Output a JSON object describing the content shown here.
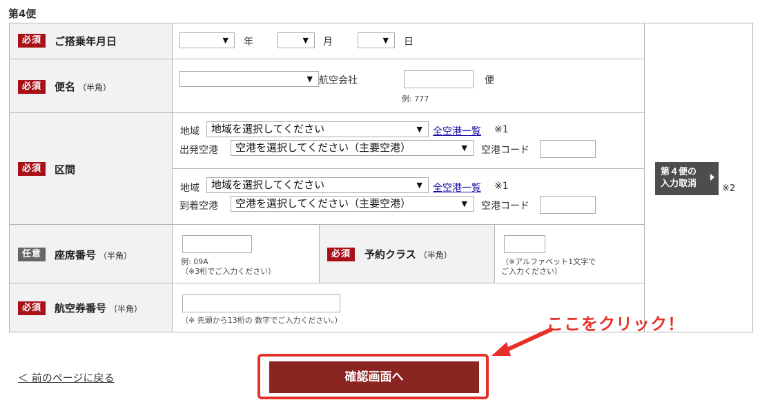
{
  "section_title": "第4便",
  "badges": {
    "required": "必須",
    "optional": "任意"
  },
  "rows": {
    "date": {
      "label": "ご搭乗年月日",
      "year_unit": "年",
      "month_unit": "月",
      "day_unit": "日"
    },
    "flight": {
      "label": "便名",
      "hint": "（半角）",
      "airline_text": "航空会社",
      "flight_unit": "便",
      "example": "例: 777"
    },
    "route": {
      "label": "区間",
      "region_label": "地域",
      "region_placeholder": "地域を選択してください",
      "all_airports_link": "全空港一覧",
      "note_mark_1": "※1",
      "departure_label": "出発空港",
      "arrival_label": "到着空港",
      "airport_placeholder": "空港を選択してください（主要空港）",
      "airport_code_label": "空港コード"
    },
    "seat": {
      "label": "座席番号",
      "hint": "（半角）",
      "example": "例: 09A",
      "note": "（※3桁でご入力ください）"
    },
    "class": {
      "label": "予約クラス",
      "hint": "（半角）",
      "note_line1": "（※アルファベット1文字で",
      "note_line2": "ご入力ください）"
    },
    "ticket": {
      "label": "航空券番号",
      "hint": "（半角）",
      "note": "（※ 先頭から13桁の 数字でご入力ください。）"
    }
  },
  "cancel_button": {
    "line1": "第４便の",
    "line2": "入力取消"
  },
  "note_mark_2": "※2",
  "back_link": "＜ 前のページに戻る",
  "confirm_button": "確認画面へ",
  "callout_text": "ここをクリック！",
  "colors": {
    "required_badge": "#a8111a",
    "optional_badge": "#666666",
    "confirm_button": "#8b2522",
    "highlight": "#e8302a"
  }
}
